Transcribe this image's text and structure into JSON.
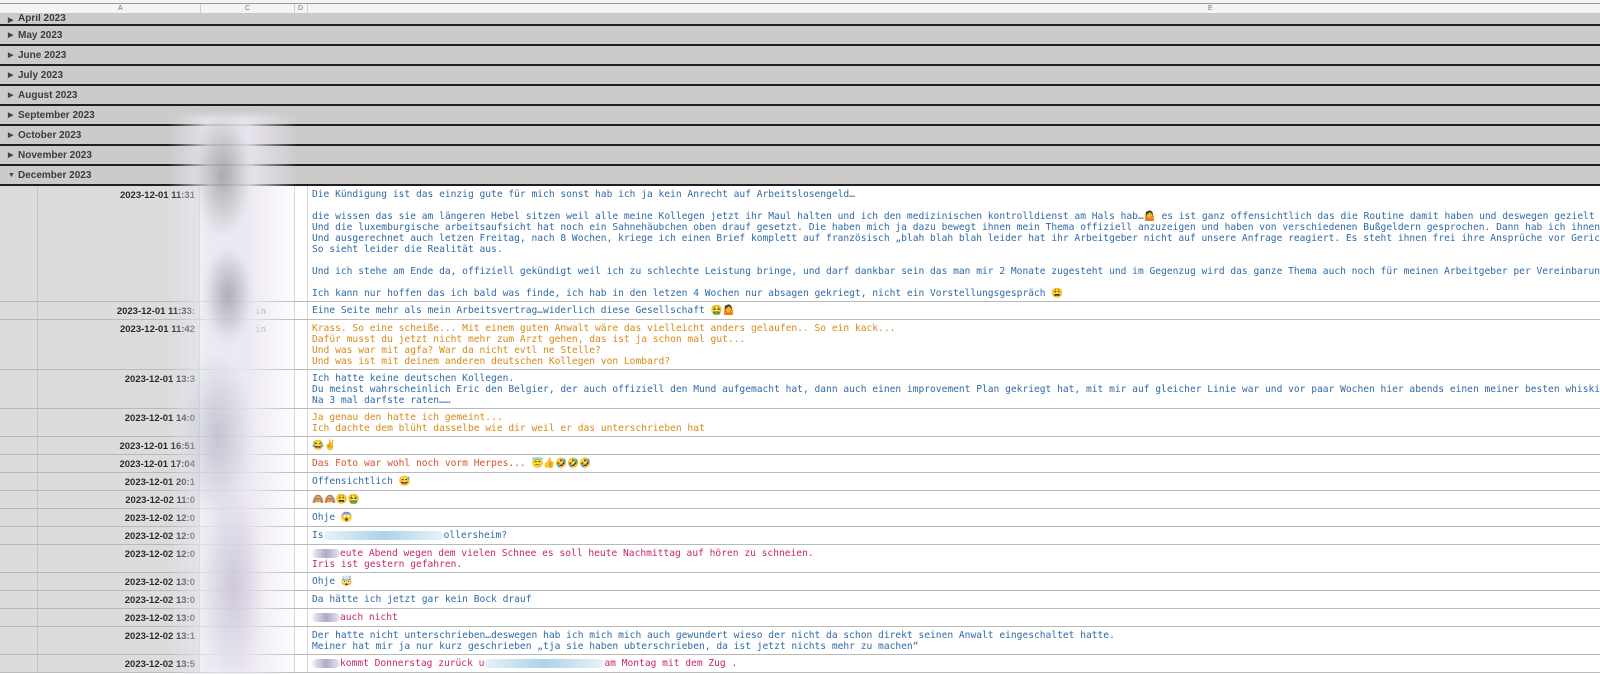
{
  "columns": [
    "A",
    "C",
    "D",
    "E"
  ],
  "groups": [
    {
      "label": "April 2023",
      "expanded": false
    },
    {
      "label": "May 2023",
      "expanded": false
    },
    {
      "label": "June 2023",
      "expanded": false
    },
    {
      "label": "July 2023",
      "expanded": false
    },
    {
      "label": "August 2023",
      "expanded": false
    },
    {
      "label": "September 2023",
      "expanded": false
    },
    {
      "label": "October 2023",
      "expanded": false
    },
    {
      "label": "November 2023",
      "expanded": false
    },
    {
      "label": "December 2023",
      "expanded": true
    }
  ],
  "glyphs": {
    "collapsed": "▶",
    "expanded": "▼"
  },
  "rows": [
    {
      "time": "2023-12-01 11:31",
      "sender": "",
      "color": "blue",
      "lines": [
        "Die Kündigung ist das einzig gute für mich sonst hab ich ja kein Anrecht auf Arbeitslosengeld…",
        "",
        "die wissen das sie am längeren Hebel sitzen weil alle meine Kollegen jetzt ihr Maul halten und ich den medizinischen kontrolldienst am Hals hab…🤷 es ist ganz offensichtlich das die Routine damit haben und deswegen gezielt alles so gesteuert",
        "Und die luxemburgische arbeitsaufsicht hat noch ein Sahnehäubchen oben drauf gesetzt. Die haben mich ja dazu bewegt ihnen mein Thema offiziell anzuzeigen und haben von verschiedenen Bußgeldern gesprochen. Dann hab ich ihnen alles zusammen",
        "Und ausgerechnet auch letzen Freitag, nach 8 Wochen, kriege ich einen Brief komplett auf französisch „blah blah blah leider hat ihr Arbeitgeber nicht auf unsere Anfrage reagiert. Es steht ihnen frei ihre Ansprüche vor Gericht geltend zu ma",
        "So sieht leider die Realität aus.",
        "",
        "Und ich stehe am Ende da, offiziell gekündigt weil ich zu schlechte Leistung bringe, und darf dankbar sein das man mir 2 Monate zugesteht und im Gegenzug wird das ganze Thema auch noch für meinen Arbeitgeber per Vereinbarung unter den Tisc",
        "",
        "Ich kann nur hoffen das ich bald was finde, ich hab in den letzen 4 Wochen nur absagen gekriegt, nicht ein Vorstellungsgespräch 😩"
      ]
    },
    {
      "time": "2023-12-01 11:33:",
      "sender": "in",
      "color": "blue",
      "lines": [
        "Eine Seite mehr als mein Arbeitsvertrag…widerlich diese Gesellschaft 🤮🤷"
      ]
    },
    {
      "time": "2023-12-01 11:42",
      "sender": "in",
      "color": "orange",
      "lines": [
        "Krass. So eine scheiße... Mit einem guten Anwalt wäre das vielleicht anders gelaufen.. So ein kack...",
        "Dafür musst du jetzt nicht mehr zum Arzt gehen, das ist ja schon mal gut...",
        "Und was war mit agfa? War da nicht evtl ne Stelle?",
        "Und was ist mit deinem anderen deutschen Kollegen von Lombard?"
      ]
    },
    {
      "time": "2023-12-01 13:3",
      "sender": "",
      "color": "blue",
      "lines": [
        "Ich hatte keine deutschen Kollegen.",
        "Du meinst wahrscheinlich Eric den Belgier, der auch offiziell den Mund aufgemacht hat, dann auch einen improvement Plan gekriegt hat, mit mir auf gleicher Linie war und vor paar Wochen hier abends einen meiner besten whiskies getrunken hat",
        "Na 3 mal darfste raten……"
      ]
    },
    {
      "time": "2023-12-01 14:0",
      "sender": "",
      "color": "orange",
      "lines": [
        "Ja genau den hatte ich gemeint...",
        "Ich dachte dem blüht dasselbe wie dir weil er das unterschrieben hat"
      ]
    },
    {
      "time": "2023-12-01 16:51",
      "sender": "",
      "color": "blue",
      "lines": [
        "😂✌️"
      ]
    },
    {
      "time": "2023-12-01 17:04",
      "sender": "",
      "color": "red",
      "lines": [
        "Das Foto war wohl noch vorm Herpes... 😇👍🤣🤣🤣"
      ]
    },
    {
      "time": "2023-12-01 20:1",
      "sender": "",
      "color": "blue",
      "lines": [
        "Offensichtlich 😅"
      ]
    },
    {
      "time": "2023-12-02 11:0",
      "sender": "",
      "color": "blue",
      "lines": [
        "🙈🙈😩🤮"
      ]
    },
    {
      "time": "2023-12-02 12:0",
      "sender": "",
      "color": "blue",
      "lines": [
        "Ohje 😱"
      ]
    },
    {
      "time": "2023-12-02 12:0",
      "sender": "",
      "color": "blue",
      "lines": [
        "Is",
        "ollersheim?"
      ],
      "redact_between": true
    },
    {
      "time": "2023-12-02 12:0",
      "sender": "",
      "color": "magenta",
      "lines": [
        "eute Abend wegen dem vielen Schnee es soll heute Nachmittag auf hören zu schneien.",
        "Iris ist gestern gefahren."
      ],
      "redact_before": true
    },
    {
      "time": "2023-12-02 13:0",
      "sender": "",
      "color": "blue",
      "lines": [
        "Ohje 🤯"
      ]
    },
    {
      "time": "2023-12-02 13:0",
      "sender": "",
      "color": "blue",
      "lines": [
        "Da hätte ich jetzt gar kein Bock drauf"
      ]
    },
    {
      "time": "2023-12-02 13:0",
      "sender": "",
      "color": "magenta",
      "lines": [
        "auch nicht"
      ],
      "redact_before": true
    },
    {
      "time": "2023-12-02 13:1",
      "sender": "",
      "color": "blue",
      "lines": [
        "Der hatte nicht unterschrieben…deswegen hab ich mich mich auch gewundert wieso der nicht da schon direkt seinen Anwalt eingeschaltet hatte.",
        "Meiner hat mir ja nur kurz geschrieben „tja sie haben ubterschrieben, da ist jetzt nichts mehr zu machen“"
      ]
    },
    {
      "time": "2023-12-02 13:5",
      "sender": "",
      "color": "magenta",
      "lines": [
        "kommt Donnerstag zurück u",
        "am Montag mit dem Zug ."
      ],
      "redact_before": true,
      "redact_between": true
    }
  ]
}
